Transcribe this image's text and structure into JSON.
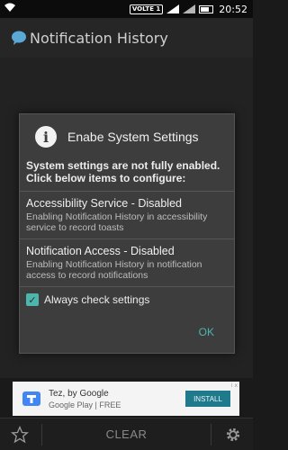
{
  "status": {
    "network_badge": "VOLTE 1",
    "battery_text": "",
    "time": "20:52"
  },
  "appbar": {
    "title": "Notification History",
    "icon": "speech-bubble-icon"
  },
  "dialog": {
    "title": "Enabe System Settings",
    "message": "System settings are not fully enabled. Click below items to configure:",
    "items": [
      {
        "title": "Accessibility Service - Disabled",
        "desc": "Enabling Notification History in accessibility service to record toasts"
      },
      {
        "title": "Notification Access - Disabled",
        "desc": "Enabling Notification History in notification access to record notifications"
      }
    ],
    "checkbox_label": "Always check settings",
    "checkbox_checked": true,
    "ok_label": "OK"
  },
  "ad": {
    "name": "Tez, by Google",
    "store": "Google Play",
    "price": "FREE",
    "install": "INSTALL",
    "corner": "i x"
  },
  "bottom": {
    "clear_label": "CLEAR",
    "left_icon": "star-icon",
    "right_icon": "gear-icon"
  },
  "colors": {
    "accent": "#4db6ac",
    "dialog_bg": "#3d3d3d",
    "install_bg": "#1f7a8c"
  }
}
